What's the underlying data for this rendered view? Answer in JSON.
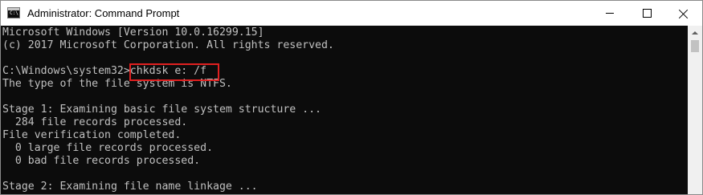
{
  "window": {
    "title": "Administrator: Command Prompt",
    "icon": "cmd-icon",
    "icon_glyph": "C:\\",
    "controls": [
      "minimize-icon",
      "maximize-icon",
      "close-icon"
    ]
  },
  "console": {
    "background": "#0c0c0c",
    "foreground": "#c0c0c0",
    "highlight_color": "#e02020",
    "lines": [
      "Microsoft Windows [Version 10.0.16299.15]",
      "(c) 2017 Microsoft Corporation. All rights reserved.",
      "",
      "C:\\Windows\\system32>chkdsk e: /f",
      "The type of the file system is NTFS.",
      "",
      "Stage 1: Examining basic file system structure ...",
      "  284 file records processed.",
      "File verification completed.",
      "  0 large file records processed.",
      "  0 bad file records processed.",
      "",
      "Stage 2: Examining file name linkage ..."
    ],
    "highlighted_command": "chkdsk e: /f"
  }
}
